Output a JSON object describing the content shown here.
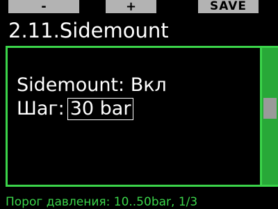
{
  "softkeys": {
    "minus_label": "-",
    "plus_label": "+",
    "save_label": "SAVE"
  },
  "header": {
    "title": "2.11.Sidemount"
  },
  "settings": {
    "sidemount_text": "Sidemount: Вкл",
    "step_label": "Шаг:",
    "step_value": "30 bar"
  },
  "scroll": {
    "position_fraction": 0.43
  },
  "footer": {
    "hint": "Порог давления: 10..50bar, 1/3"
  },
  "colors": {
    "accent_green": "#3bd44a",
    "scrollbar_green": "#28a838",
    "softkey_gray": "#b3b3b3",
    "background": "#000000",
    "text": "#ffffff"
  }
}
